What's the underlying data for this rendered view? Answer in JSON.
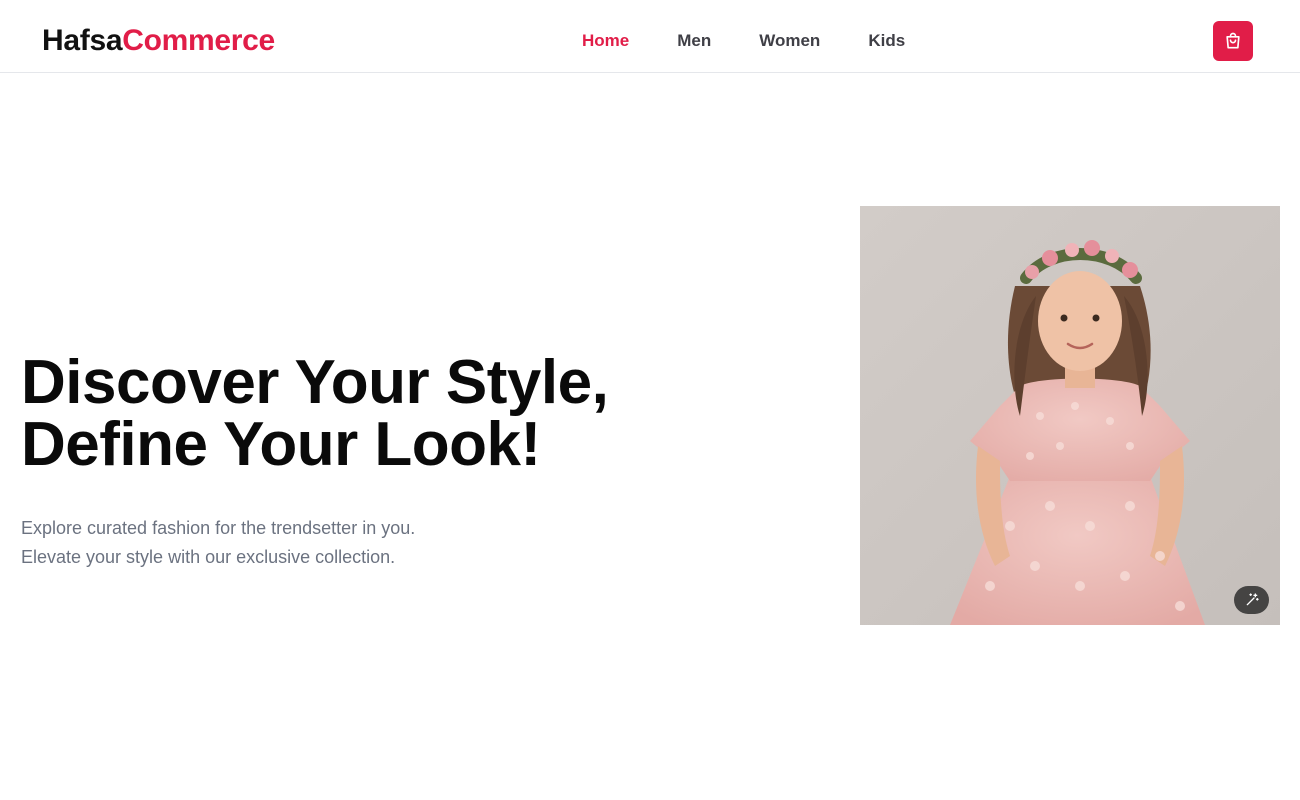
{
  "brand": {
    "part1": "Hafsa",
    "part2": "Commerce",
    "part1_color": "#111111",
    "part2_color": "#e11d48"
  },
  "nav": {
    "items": [
      {
        "label": "Home",
        "active": true
      },
      {
        "label": "Men",
        "active": false
      },
      {
        "label": "Women",
        "active": false
      },
      {
        "label": "Kids",
        "active": false
      }
    ],
    "active_color": "#e11d48",
    "inactive_color": "#3f3f46"
  },
  "cart": {
    "icon": "shopping-bag-icon",
    "color": "#e11d48"
  },
  "hero": {
    "title_line1": "Discover Your Style,",
    "title_line2": "Define Your Look!",
    "subtitle_line1": "Explore curated fashion for the trendsetter in you.",
    "subtitle_line2": "Elevate your style with our exclusive collection.",
    "image_icon": "magic-wand-icon"
  }
}
